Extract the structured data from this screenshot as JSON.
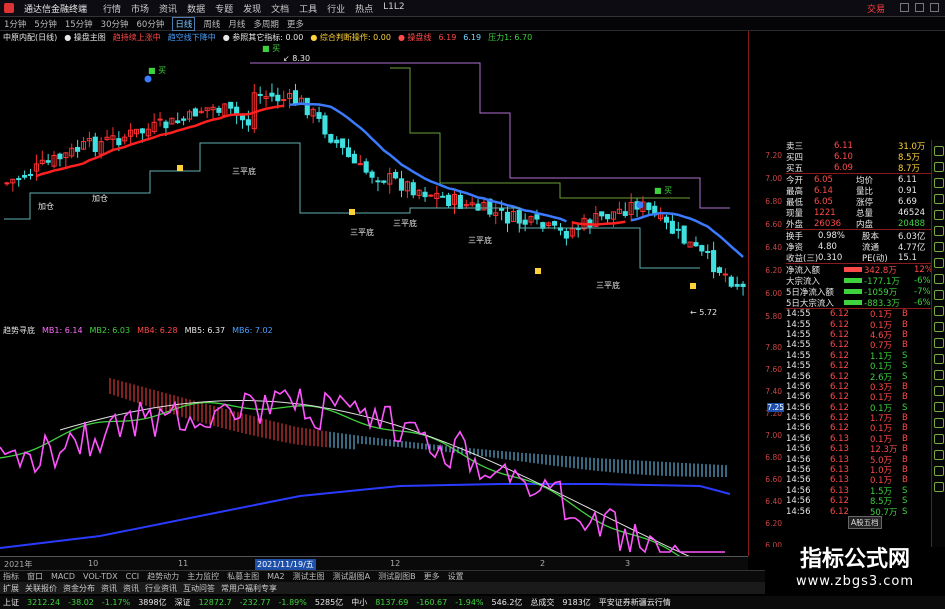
{
  "window": {
    "title": "通达信金融终端",
    "menu": [
      "行情",
      "市场",
      "资讯",
      "数据",
      "专题",
      "发现",
      "文档",
      "工具",
      "行业",
      "热点",
      "L1L2"
    ],
    "right_label": "交易"
  },
  "periods": [
    "1分钟",
    "5分钟",
    "15分钟",
    "30分钟",
    "60分钟",
    "日线",
    "周线",
    "月线",
    "多周期",
    "更多"
  ],
  "active_period": "日线",
  "main_indicators": [
    {
      "text": "中原内配(日线)",
      "color": "#e8e8e8"
    },
    {
      "text": "● 操盘主图",
      "color": "#e8e8e8"
    },
    {
      "text": "趋持续上涨中",
      "color": "#ff4a4a"
    },
    {
      "text": "趋空线下降中",
      "color": "#4aa0ff"
    },
    {
      "text": "● 参照其它指标: 0.00",
      "color": "#e8e8e8"
    },
    {
      "text": "● 综合判断操作: 0.00",
      "color": "#ffd23a"
    },
    {
      "text": "● 操盘线",
      "color": "#ff4a4a"
    },
    {
      "text": "6.19",
      "color": "#ff4a4a"
    },
    {
      "text": "6.19",
      "color": "#6fd8ff"
    },
    {
      "text": "压力1: 6.70",
      "color": "#3fd23f"
    }
  ],
  "osc_indicators": [
    {
      "text": "趋势寻底",
      "color": "#e8e8e8"
    },
    {
      "text": "MB1: 6.14",
      "color": "#ff6fff"
    },
    {
      "text": "MB2: 6.03",
      "color": "#3fd23f"
    },
    {
      "text": "MB4: 6.28",
      "color": "#ff4a4a"
    },
    {
      "text": "MB5: 6.37",
      "color": "#e8e8e8"
    },
    {
      "text": "MB6: 7.02",
      "color": "#4aa0ff"
    }
  ],
  "chart_labels": {
    "high_mark": "8.30",
    "low_mark": "5.72",
    "signals": [
      "加仓",
      "加仓",
      "三平底",
      "三平底",
      "三平底",
      "三平底",
      "三平底"
    ],
    "buy": "买"
  },
  "price_axis": [
    "7.20",
    "7.00",
    "6.80",
    "6.60",
    "6.40",
    "6.20",
    "6.00",
    "5.80"
  ],
  "osc_axis": [
    "7.80",
    "7.60",
    "7.40",
    "7.20",
    "7.00",
    "6.80",
    "6.60",
    "6.40",
    "6.20",
    "6.00"
  ],
  "osc_current": "7.25",
  "quote_top": [
    {
      "label": "卖三",
      "price": "6.11",
      "vol": "31.0万"
    },
    {
      "label": "买四",
      "price": "6.10",
      "vol": "8.5万"
    },
    {
      "label": "买五",
      "price": "6.09",
      "vol": "8.7万"
    }
  ],
  "quote_stats": [
    {
      "l1": "今开",
      "v1": "6.05",
      "l2": "均价",
      "v2": "6.11"
    },
    {
      "l1": "最高",
      "v1": "6.14",
      "l2": "量比",
      "v2": "0.91"
    },
    {
      "l1": "最低",
      "v1": "6.05",
      "l2": "涨停",
      "v2": "6.69"
    },
    {
      "l1": "现量",
      "v1": "1221",
      "l2": "总量",
      "v2": "46524"
    },
    {
      "l1": "外盘",
      "v1": "26036",
      "l2": "内盘",
      "v2": "20488"
    }
  ],
  "quote_stats2": [
    {
      "l1": "换手",
      "v1": "0.98%",
      "l2": "股本",
      "v2": "6.03亿"
    },
    {
      "l1": "净资",
      "v1": "4.80",
      "l2": "流通",
      "v2": "4.77亿"
    },
    {
      "l1": "收益(三)",
      "v1": "0.310",
      "l2": "PE(动)",
      "v2": "15.1"
    }
  ],
  "flows": [
    {
      "label": "净流入额",
      "val": "342.8万",
      "pct": "12%"
    },
    {
      "label": "大宗流入",
      "val": "-177.1万",
      "pct": "-6%"
    },
    {
      "label": "5日净流入额",
      "val": "-1059万",
      "pct": "-7%"
    },
    {
      "label": "5日大宗流入",
      "val": "-883.3万",
      "pct": "-6%"
    }
  ],
  "ticks": [
    {
      "t": "14:55",
      "p": "6.12",
      "v": "0.1万",
      "s": "B"
    },
    {
      "t": "14:55",
      "p": "6.12",
      "v": "0.1万",
      "s": "B"
    },
    {
      "t": "14:55",
      "p": "6.12",
      "v": "4.6万",
      "s": "B"
    },
    {
      "t": "14:55",
      "p": "6.12",
      "v": "0.7万",
      "s": "B"
    },
    {
      "t": "14:55",
      "p": "6.12",
      "v": "1.1万",
      "s": "S"
    },
    {
      "t": "14:55",
      "p": "6.12",
      "v": "0.1万",
      "s": "S"
    },
    {
      "t": "14:56",
      "p": "6.12",
      "v": "2.6万",
      "s": "S"
    },
    {
      "t": "14:56",
      "p": "6.12",
      "v": "0.3万",
      "s": "B"
    },
    {
      "t": "14:56",
      "p": "6.12",
      "v": "0.1万",
      "s": "B"
    },
    {
      "t": "14:56",
      "p": "6.12",
      "v": "0.1万",
      "s": "S"
    },
    {
      "t": "14:56",
      "p": "6.12",
      "v": "1.7万",
      "s": "B"
    },
    {
      "t": "14:56",
      "p": "6.12",
      "v": "0.1万",
      "s": "B"
    },
    {
      "t": "14:56",
      "p": "6.13",
      "v": "0.1万",
      "s": "B"
    },
    {
      "t": "14:56",
      "p": "6.13",
      "v": "12.3万",
      "s": "B"
    },
    {
      "t": "14:56",
      "p": "6.13",
      "v": "5.0万",
      "s": "B"
    },
    {
      "t": "14:56",
      "p": "6.13",
      "v": "1.0万",
      "s": "B"
    },
    {
      "t": "14:56",
      "p": "6.13",
      "v": "0.1万",
      "s": "B"
    },
    {
      "t": "14:56",
      "p": "6.13",
      "v": "1.5万",
      "s": "S"
    },
    {
      "t": "14:56",
      "p": "6.12",
      "v": "8.5万",
      "s": "S"
    },
    {
      "t": "14:56",
      "p": "6.12",
      "v": "50.7万",
      "s": "S"
    }
  ],
  "tick_badge": "A股五档",
  "dates": [
    {
      "text": "2021年",
      "hl": false
    },
    {
      "text": "10",
      "hl": false
    },
    {
      "text": "11",
      "hl": false
    },
    {
      "text": "2021/11/19/五",
      "hl": true
    },
    {
      "text": "12",
      "hl": false
    },
    {
      "text": "2",
      "hl": false
    },
    {
      "text": "3",
      "hl": false
    }
  ],
  "bottom_tabs": [
    "指标",
    "窗口",
    "MACD",
    "VOL-TDX",
    "CCI",
    "趋势动力",
    "主力监控",
    "私募主图",
    "MA2",
    "测试主图",
    "测试副图A",
    "测试副图B",
    "更多",
    "设置"
  ],
  "bottom_right": "板块",
  "status_tabs": [
    "扩展",
    "关联报价",
    "资金分布",
    "资讯",
    "资讯",
    "行业资讯",
    "互动问答",
    "常用户福利专享"
  ],
  "status_right": "同花/10",
  "indices": [
    {
      "name": "上证",
      "val": "3212.24",
      "chg": "-38.02",
      "pct": "-1.17%",
      "amt": "3898亿"
    },
    {
      "name": "深证",
      "val": "12872.7",
      "chg": "-232.77",
      "pct": "-1.89%",
      "amt": "5285亿"
    },
    {
      "name": "中小",
      "val": "8137.69",
      "chg": "-160.67",
      "pct": "-1.94%",
      "amt": "546.2亿"
    }
  ],
  "total": {
    "label": "总成交",
    "amt": "9183亿"
  },
  "broker": "平安证券新疆云行情",
  "watermark": {
    "big": "指标公式网",
    "small": "www.zbgs3.com"
  }
}
